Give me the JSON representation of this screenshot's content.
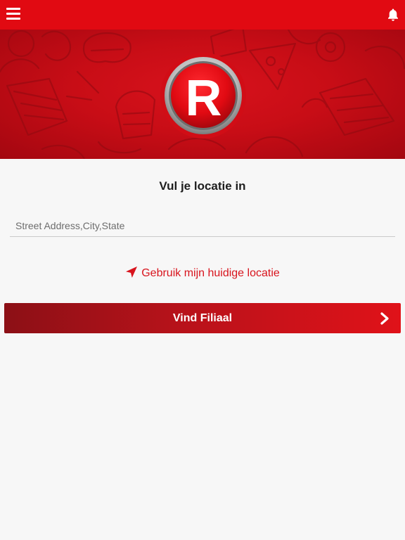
{
  "header": {
    "menu_icon": "hamburger-menu-icon",
    "notifications_icon": "bell-icon",
    "accent_color": "#e10a12"
  },
  "banner": {
    "logo_letter": "R",
    "background_color": "#c80d16"
  },
  "main": {
    "title": "Vul je locatie in",
    "address_input": {
      "placeholder": "Street Address,City,State",
      "value": ""
    },
    "use_location_label": "Gebruik mijn huidige locatie",
    "use_location_icon": "location-arrow-icon",
    "find_button_label": "Vind Filiaal",
    "find_button_icon": "chevron-right-icon"
  }
}
